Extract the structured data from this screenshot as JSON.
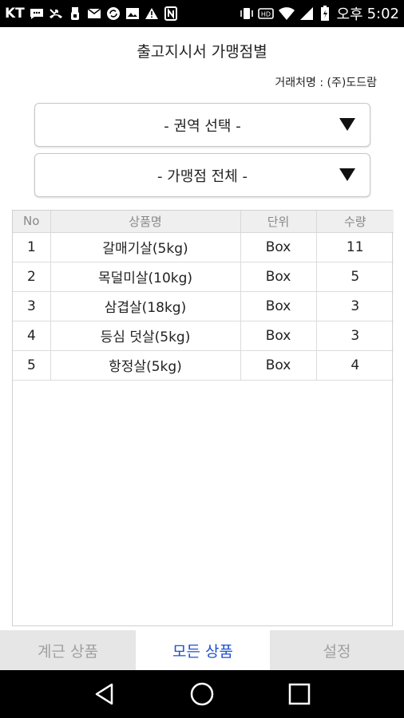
{
  "status_bar": {
    "carrier": "KT",
    "time_prefix": "오후",
    "time": "5:02",
    "icons": [
      "message-icon",
      "missed-call-icon",
      "usb-icon",
      "mail-icon",
      "sync-icon",
      "gallery-icon",
      "warning-icon",
      "nfc-icon",
      "vibrate-icon",
      "hd-icon",
      "wifi-icon",
      "signal-icon",
      "battery-icon"
    ]
  },
  "header": {
    "title": "출고지시서 가맹점별",
    "customer": "거래처명 : (주)도드람"
  },
  "filters": {
    "region": {
      "selected": "- 권역 선택 -"
    },
    "store": {
      "selected": "- 가맹점 전체 -"
    }
  },
  "table": {
    "columns": [
      "No",
      "상품명",
      "단위",
      "수량"
    ],
    "rows": [
      {
        "no": "1",
        "name": "갈매기살(5kg)",
        "unit": "Box",
        "qty": "11"
      },
      {
        "no": "2",
        "name": "목덜미살(10kg)",
        "unit": "Box",
        "qty": "5"
      },
      {
        "no": "3",
        "name": "삼겹살(18kg)",
        "unit": "Box",
        "qty": "3"
      },
      {
        "no": "4",
        "name": "등심 덧살(5kg)",
        "unit": "Box",
        "qty": "3"
      },
      {
        "no": "5",
        "name": "항정살(5kg)",
        "unit": "Box",
        "qty": "4"
      }
    ]
  },
  "tabs": [
    {
      "label": "계근 상품",
      "active": false
    },
    {
      "label": "모든 상품",
      "active": true
    },
    {
      "label": "설정",
      "active": false
    }
  ],
  "colors": {
    "active_tab_text": "#1e4fd0",
    "inactive_tab_text": "#a0a0a0",
    "tab_bar_bg": "#e6e6e6"
  }
}
